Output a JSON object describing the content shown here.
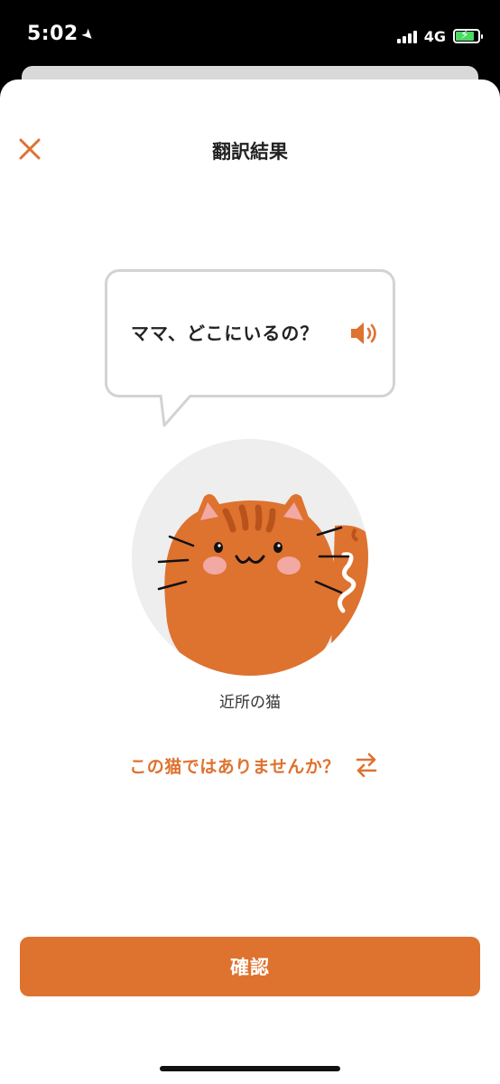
{
  "status_bar": {
    "time": "5:02",
    "location_icon": "location-arrow-icon",
    "network": "4G",
    "battery_color": "#4cd964"
  },
  "header": {
    "title": "翻訳結果",
    "close_icon": "close-icon"
  },
  "translation": {
    "text": "ママ、どこにいるの？",
    "speaker_icon": "speaker-icon"
  },
  "cat": {
    "name": "近所の猫",
    "avatar_icon": "orange-cat-illustration"
  },
  "switch_cat": {
    "label": "この猫ではありませんか？",
    "icon": "swap-arrows-icon"
  },
  "confirm_button": {
    "label": "確認"
  },
  "colors": {
    "accent": "#de722f",
    "cat_orange": "#de722f",
    "bubble_border": "#d3d3d3"
  }
}
